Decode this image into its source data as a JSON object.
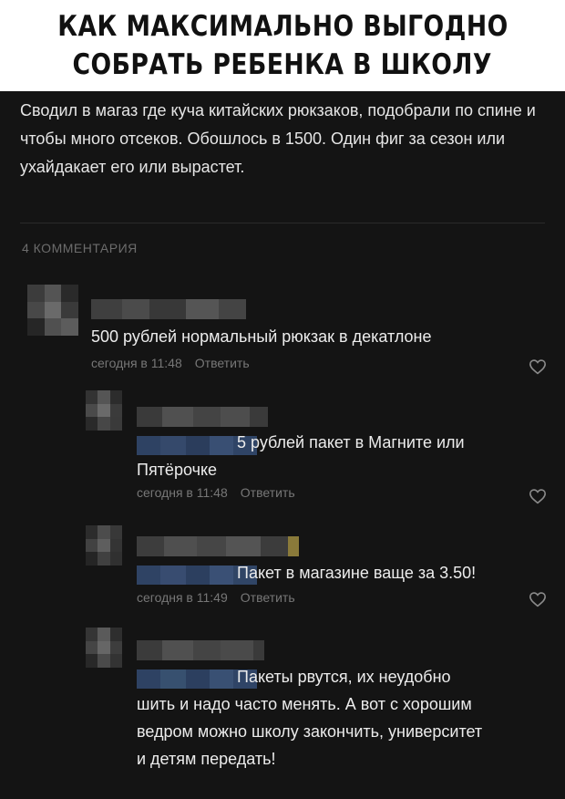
{
  "header": {
    "line1": "КАК МАКСИМАЛЬНО ВЫГОДНО",
    "line2": "СОБРАТЬ РЕБЕНКА В ШКОЛУ"
  },
  "post": {
    "text": "Сводил в магаз где куча китайских рюкзаков, подобрали по спине и чтобы много отсеков. Обошлось в 1500. Один фиг за сезон или ухайдакает его или вырастет."
  },
  "comments_count": "4 КОММЕНТАРИЯ",
  "comments": [
    {
      "text": "500 рублей нормальный рюкзак в декатлоне",
      "time": "сегодня в 11:48",
      "reply": "Ответить"
    },
    {
      "text": "5 рублей пакет в Магните или Пятёрочке",
      "time": "сегодня в 11:48",
      "reply": "Ответить"
    },
    {
      "text": "Пакет в магазине ваще за 3.50!",
      "time": "сегодня в 11:49",
      "reply": "Ответить"
    },
    {
      "text": "Пакеты рвутся, их неудобно шить и надо часто менять. А вот с хорошим ведром можно школу закончить, университет и детям передать!"
    }
  ],
  "colors": {
    "background": "#141414",
    "header_bg": "#ffffff",
    "text": "#e6e6e6",
    "muted": "#777777",
    "mention_blue": "#31476a"
  },
  "icons": {
    "like": "heart-outline-icon"
  }
}
